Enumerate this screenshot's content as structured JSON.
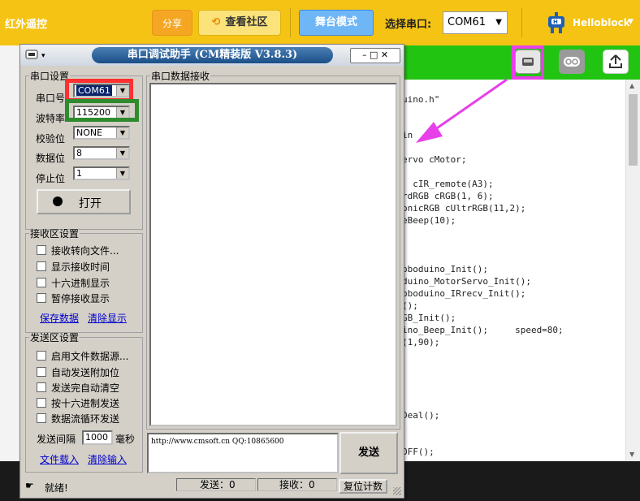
{
  "toolbar": {
    "app_title": "红外遥控",
    "share_label": "分享",
    "community_icon": "link-icon",
    "community_glyph": "⟲",
    "community_label": "查看社区",
    "stage_label": "舞台模式",
    "port_label": "选择串口:",
    "port_value": "COM61",
    "brand": "Helloblock",
    "colors": {
      "toolbar_bg": "#f5c314",
      "stage_btn": "#6fb6f7",
      "green_bar": "#22c412",
      "highlight": "#e840e8"
    }
  },
  "code_lines": [
    "uino.h\"",
    "in",
    "ervo cMotor;",
    "  cIR_remote(A3);",
    "rdRGB cRGB(1, 6);",
    "onicRGB cUltrRGB(11,2);",
    "eBeep(10);",
    "oboduino_Init();",
    "duino_MotorServo_Init();",
    "oboduino_IRrecv_Init();",
    "();",
    "GB_Init();",
    "ino_Beep_Init();     speed=80;",
    "(1,90);",
    "Deal();",
    "OFF();"
  ],
  "serial": {
    "title": "串口调试助手 (CM精装版 V3.8.3)",
    "port_group": "串口设置",
    "port_label": "串口号",
    "port_value": "COM61",
    "baud_label": "波特率",
    "baud_value": "115200",
    "parity_label": "校验位",
    "parity_value": "NONE",
    "data_label": "数据位",
    "data_value": "8",
    "stop_label": "停止位",
    "stop_value": "1",
    "open_label": "打开",
    "recv_group": "接收区设置",
    "recv_options": [
      "接收转向文件...",
      "显示接收时间",
      "十六进制显示",
      "暂停接收显示"
    ],
    "save_data": "保存数据",
    "clear_display": "清除显示",
    "send_group": "发送区设置",
    "send_options": [
      "启用文件数据源...",
      "自动发送附加位",
      "发送完自动清空",
      "按十六进制发送",
      "数据流循环发送"
    ],
    "interval_label": "发送间隔",
    "interval_value": "1000",
    "interval_unit": "毫秒",
    "file_load": "文件载入",
    "clear_input": "清除输入",
    "recv_area_label": "串口数据接收",
    "send_text": "http://www.cmsoft.cn QQ:10865600",
    "send_button": "发送",
    "status": "就绪!",
    "sent_count": "发送：0",
    "recv_count": "接收：0",
    "reset_count": "复位计数"
  }
}
